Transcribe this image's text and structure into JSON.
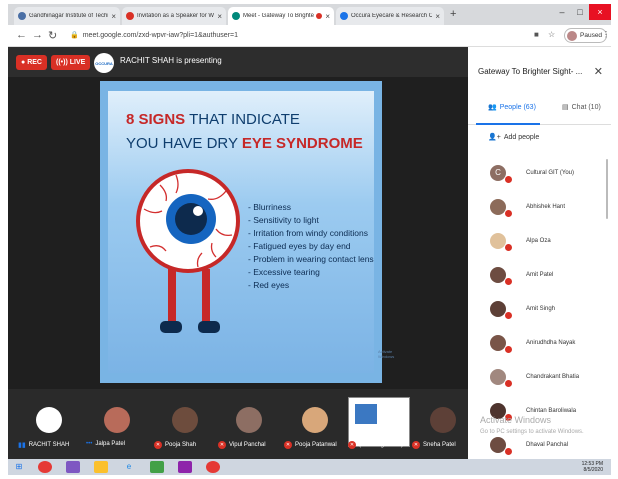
{
  "tabs": [
    {
      "title": "Gandhinagar Institute of Technol",
      "color": "#4a6fa5",
      "active": false
    },
    {
      "title": "Invitation as a Speaker for Webi",
      "color": "#d93025",
      "active": false
    },
    {
      "title": "Meet - Gateway To Brighter",
      "color": "#00897b",
      "active": true
    },
    {
      "title": "Occura Eyecare & Research Cent",
      "color": "#1a73e8",
      "active": false
    }
  ],
  "url": "meet.google.com/zxd-wpvr-iaw?pli=1&authuser=1",
  "profile_status": "Paused",
  "meet": {
    "rec_label": "REC",
    "live_label": "LIVE",
    "logo_text": "OCCURA",
    "presenting_text": "RACHIT SHAH is presenting"
  },
  "slide": {
    "title_line1_bold": "8 SIGNS",
    "title_line1_rest": " THAT INDICATE",
    "title_line2_rest": "YOU HAVE DRY ",
    "title_line2_bold": "EYE SYNDROME",
    "bullets": [
      "- Blurriness",
      "- Sensitivity to light",
      "- Irritation from windy conditions",
      "- Fatigued eyes by day end",
      "- Problem in wearing contact lens",
      "- Excessive tearing",
      "- Red eyes"
    ],
    "watermark": "Activate Windows"
  },
  "strip": [
    {
      "name": "RACHIT SHAH",
      "muted": false
    },
    {
      "name": "Jalpa Patel",
      "muted": false
    },
    {
      "name": "Pooja Shah",
      "muted": true
    },
    {
      "name": "Vipul Panchal",
      "muted": true
    },
    {
      "name": "Pooja Patanwal",
      "muted": true
    },
    {
      "name": "(suman gidwani)",
      "muted": true
    },
    {
      "name": "Sneha Patel",
      "muted": true
    }
  ],
  "panel": {
    "title": "Gateway To Brighter Sight- ...",
    "people_tab": "People (63)",
    "chat_tab": "Chat (10)",
    "add_people": "Add people",
    "people": [
      {
        "name": "Cultural GIT (You)",
        "initial": "C"
      },
      {
        "name": "Abhishek Hant"
      },
      {
        "name": "Alpa Oza"
      },
      {
        "name": "Amit Patel"
      },
      {
        "name": "Amit Singh"
      },
      {
        "name": "Anirudhdha Nayak"
      },
      {
        "name": "Chandrakant Bhatia"
      },
      {
        "name": "Chintan Baroliwala"
      },
      {
        "name": "Dhaval Panchal"
      }
    ],
    "activate_line1": "Activate Windows",
    "activate_line2": "Go to PC settings to activate Windows."
  },
  "tray": {
    "time": "12:53 PM",
    "date": "8/5/2020"
  }
}
